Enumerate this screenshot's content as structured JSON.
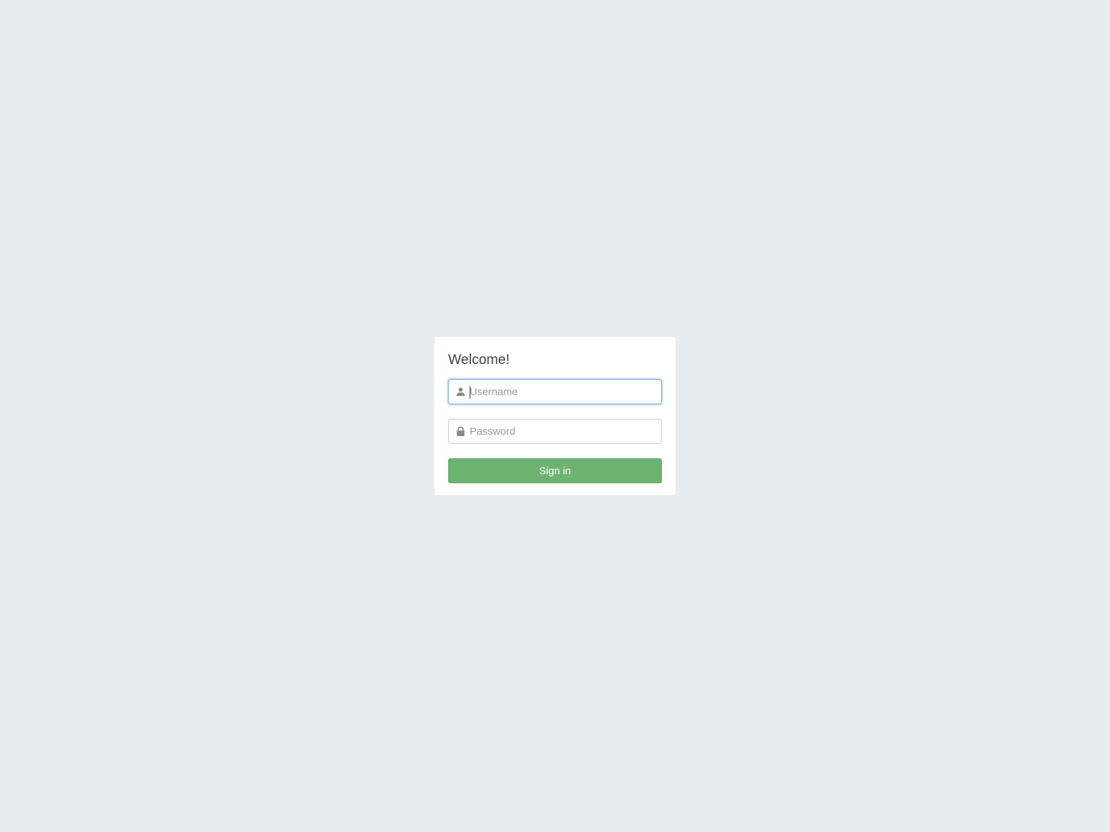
{
  "login": {
    "title": "Welcome!",
    "username": {
      "placeholder": "Username",
      "value": "",
      "icon": "user-icon",
      "focused": true
    },
    "password": {
      "placeholder": "Password",
      "value": "",
      "icon": "lock-icon"
    },
    "signin_label": "Sign in"
  },
  "colors": {
    "background": "#e8ecef",
    "card": "#ffffff",
    "button": "#6db470",
    "focus_ring": "#7db3e3",
    "icon": "#8a8a8a"
  }
}
